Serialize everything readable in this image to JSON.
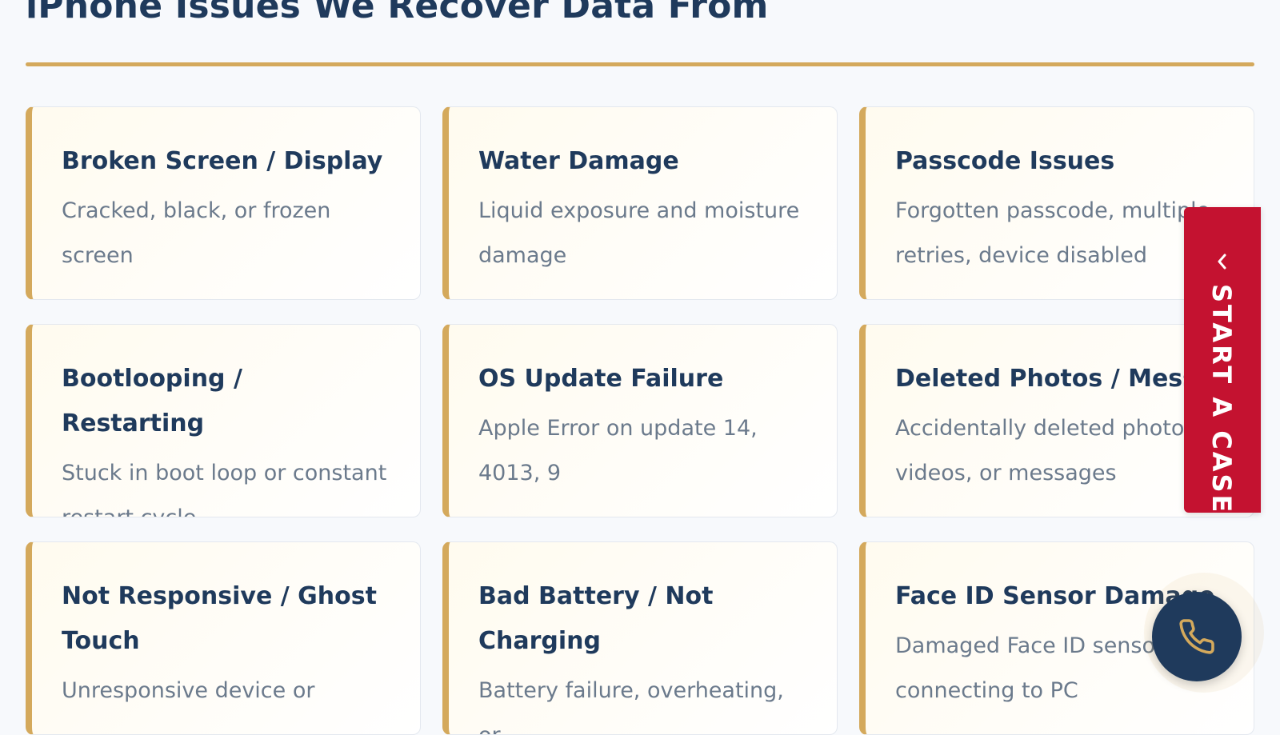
{
  "header": {
    "title": "iPhone Issues We Recover Data From"
  },
  "cards": [
    {
      "title": "Broken Screen / Display",
      "description": "Cracked, black, or frozen screen"
    },
    {
      "title": "Water Damage",
      "description": "Liquid exposure and moisture damage"
    },
    {
      "title": "Passcode Issues",
      "description": "Forgotten passcode, multiple retries, device disabled"
    },
    {
      "title": "Bootlooping / Restarting",
      "description": "Stuck in boot loop or constant restart cycle"
    },
    {
      "title": "OS Update Failure",
      "description": "Apple Error on update 14, 4013, 9"
    },
    {
      "title": "Deleted Photos / Messages",
      "description": "Accidentally deleted photos, videos, or messages"
    },
    {
      "title": "Not Responsive / Ghost Touch",
      "description": "Unresponsive device or"
    },
    {
      "title": "Bad Battery / Not Charging",
      "description": "Battery failure, overheating, or"
    },
    {
      "title": "Face ID Sensor Damage",
      "description": "Damaged Face ID sensor connecting to PC"
    }
  ],
  "side_tab": {
    "label": "START A CASE",
    "icon": "chevron-left-icon"
  },
  "call_button": {
    "icon": "phone-icon"
  },
  "colors": {
    "navy": "#1f3a5c",
    "gold": "#d4a95c",
    "red": "#c41230",
    "muted_text": "#6b7a8c"
  }
}
